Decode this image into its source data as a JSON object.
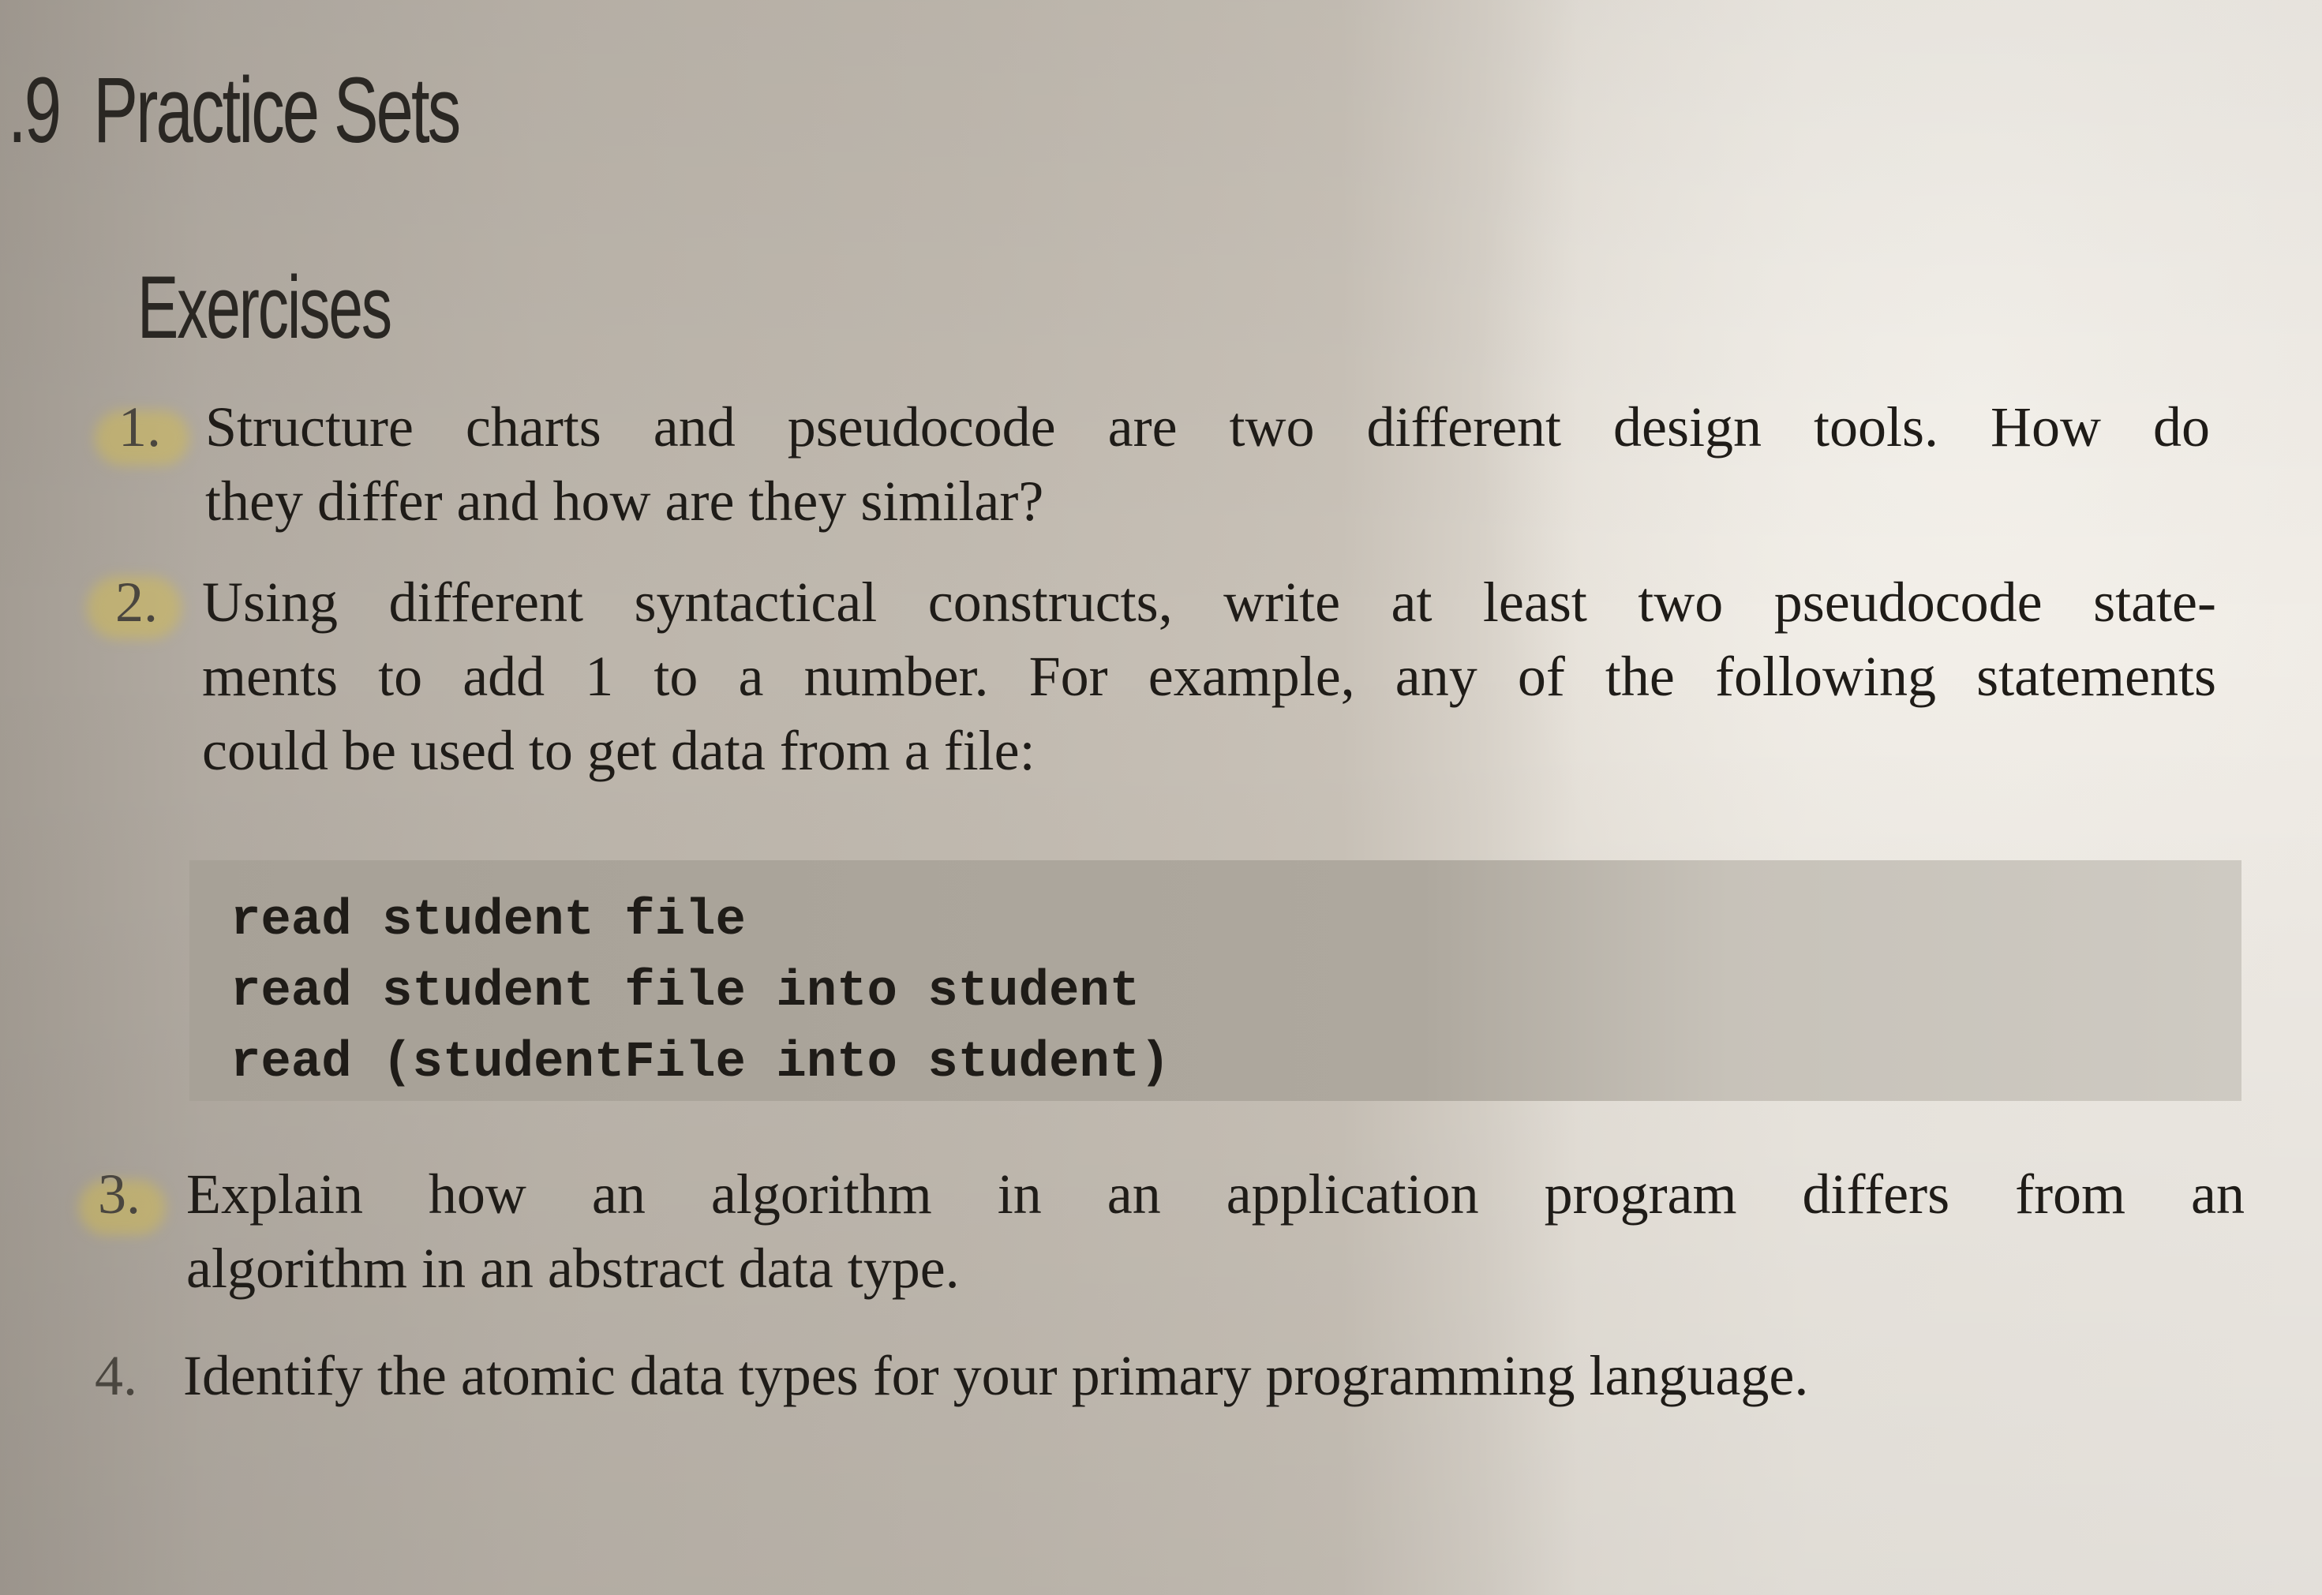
{
  "section": {
    "number": ".9",
    "title": "Practice Sets"
  },
  "subsection": {
    "title": "Exercises"
  },
  "exercises": [
    {
      "number": "1.",
      "lines": [
        "Structure charts and pseudocode are two different design tools. How do",
        "they differ and how are they similar?"
      ]
    },
    {
      "number": "2.",
      "lines": [
        "Using different syntactical constructs, write at least two pseudocode state-",
        "ments to add 1 to a number. For example, any of the following statements",
        "could be used to get data from a file:"
      ]
    },
    {
      "number": "3.",
      "lines": [
        "Explain how an algorithm in an application program differs from an",
        "algorithm in an abstract data type."
      ]
    },
    {
      "number": "4.",
      "lines": [
        "Identify the atomic data types for your primary programming language."
      ]
    }
  ],
  "code_example": {
    "lines": [
      "read student file",
      "read student file into student",
      "read (studentFile into student)"
    ]
  }
}
